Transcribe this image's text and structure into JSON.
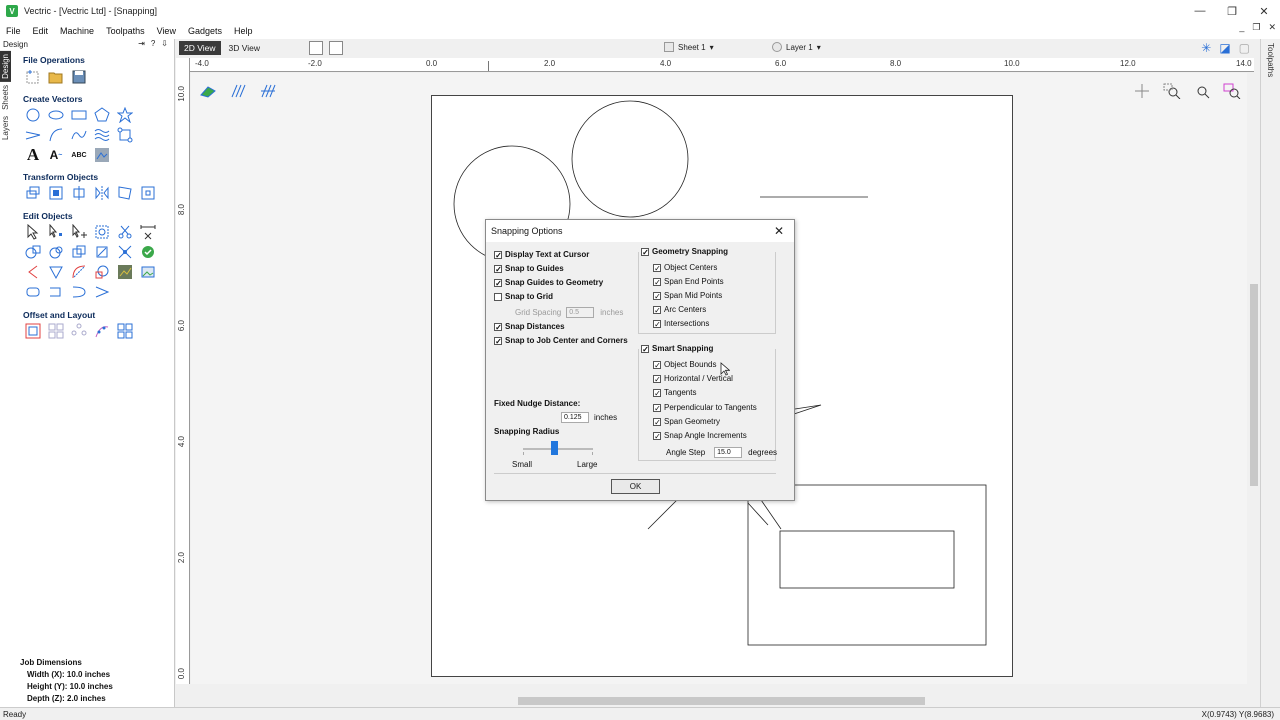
{
  "window": {
    "title": "Vectric - [Vectric Ltd] - [Snapping]",
    "app_icon_letter": "V",
    "minimize": "—",
    "maximize": "❐",
    "close": "✕"
  },
  "menu": {
    "items": [
      "File",
      "Edit",
      "Machine",
      "Toolpaths",
      "View",
      "Gadgets",
      "Help"
    ],
    "mdi_min": "_",
    "mdi_restore": "❐",
    "mdi_close": "✕"
  },
  "left_panel": {
    "header": "Design",
    "header_icons": [
      "⇥",
      "?",
      "⇩"
    ],
    "side_tabs": [
      "Design",
      "Sheets",
      "Layers"
    ],
    "sections": {
      "file_operations": "File Operations",
      "create_vectors": "Create Vectors",
      "transform_objects": "Transform Objects",
      "edit_objects": "Edit Objects",
      "offset_layout": "Offset and Layout"
    },
    "job_dimensions": {
      "title": "Job Dimensions",
      "width": "Width  (X): 10.0 inches",
      "height": "Height (Y): 10.0 inches",
      "depth": "Depth  (Z): 2.0 inches"
    }
  },
  "viewbar": {
    "tab_2d": "2D View",
    "tab_3d": "3D View",
    "sheet": "Sheet 1",
    "layer": "Layer 1",
    "dropdown_arrow": "▾"
  },
  "right_tabs": [
    "Toolpaths"
  ],
  "rulers": {
    "h_labels": [
      "-4.0",
      "-2.0",
      "0.0",
      "2.0",
      "4.0",
      "6.0",
      "8.0",
      "10.0",
      "12.0",
      "14.0"
    ],
    "v_labels": [
      "10.0",
      "8.0",
      "6.0",
      "4.0",
      "2.0",
      "0.0"
    ]
  },
  "status": {
    "left": "Ready",
    "right": "X(0.9743) Y(8.9683)"
  },
  "dialog": {
    "title": "Snapping Options",
    "close": "✕",
    "left_options": [
      {
        "label": "Display Text at Cursor",
        "checked": true
      },
      {
        "label": "Snap to Guides",
        "checked": true
      },
      {
        "label": "Snap Guides to Geometry",
        "checked": true
      },
      {
        "label": "Snap to Grid",
        "checked": false
      }
    ],
    "grid_spacing_label": "Grid Spacing",
    "grid_spacing_value": "0.5",
    "grid_spacing_unit": "inches",
    "left_options2": [
      {
        "label": "Snap Distances",
        "checked": true
      },
      {
        "label": "Snap to Job Center and Corners",
        "checked": true
      }
    ],
    "nudge_label": "Fixed Nudge Distance:",
    "nudge_value": "0.125",
    "nudge_unit": "inches",
    "radius_label": "Snapping Radius",
    "radius_small": "Small",
    "radius_large": "Large",
    "radius_level": 0.45,
    "geometry": {
      "label": "Geometry Snapping",
      "checked": true,
      "items": [
        {
          "label": "Object Centers",
          "checked": true
        },
        {
          "label": "Span End Points",
          "checked": true
        },
        {
          "label": "Span Mid Points",
          "checked": true
        },
        {
          "label": "Arc Centers",
          "checked": true
        },
        {
          "label": "Intersections",
          "checked": true
        }
      ]
    },
    "smart": {
      "label": "Smart Snapping",
      "checked": true,
      "items": [
        {
          "label": "Object Bounds",
          "checked": true
        },
        {
          "label": "Horizontal / Vertical",
          "checked": true
        },
        {
          "label": "Tangents",
          "checked": true
        },
        {
          "label": "Perpendicular to Tangents",
          "checked": true
        },
        {
          "label": "Span Geometry",
          "checked": true
        },
        {
          "label": "Snap Angle Increments",
          "checked": true
        }
      ]
    },
    "angle_label": "Angle Step",
    "angle_value": "15.0",
    "angle_unit": "degrees",
    "ok": "OK"
  },
  "colors": {
    "icon_blue": "#2a6fd6",
    "section_title": "#0b2a5a",
    "slider": "#2277dd",
    "active_tab": "#3a3a3a"
  }
}
